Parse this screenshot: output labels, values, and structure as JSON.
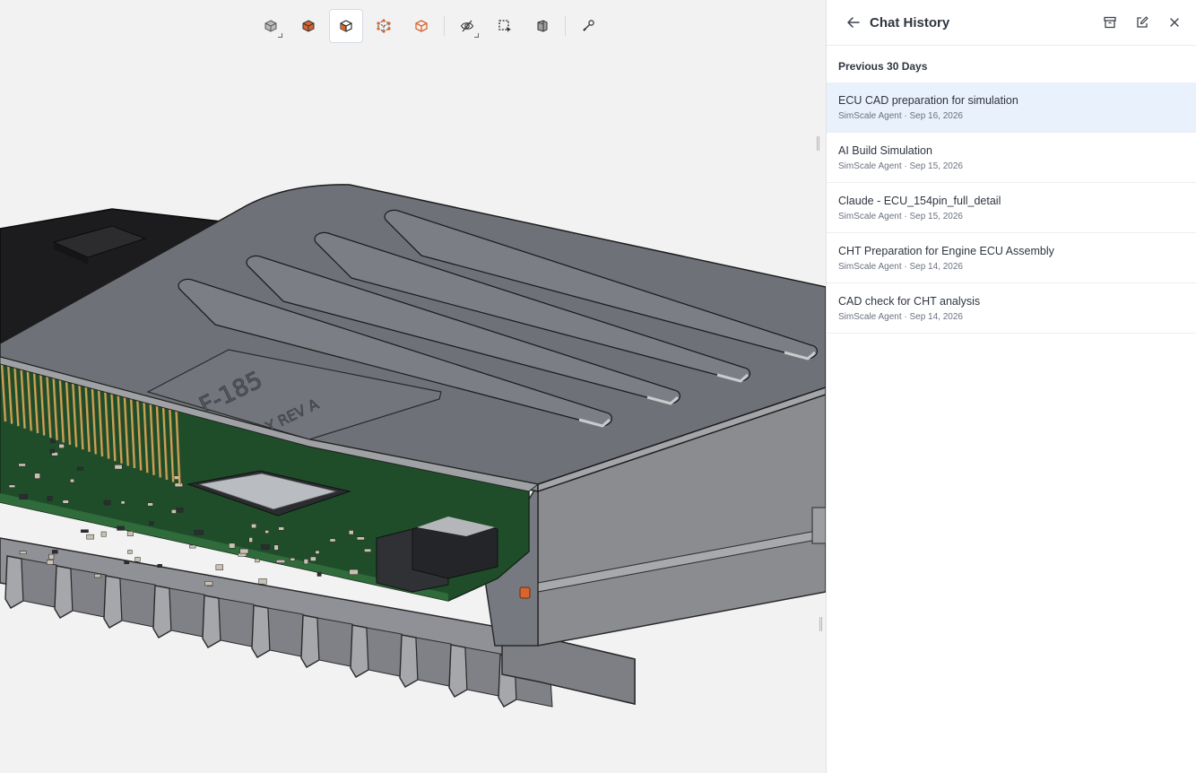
{
  "toolbar": {
    "tools": [
      {
        "name": "shaded-view-icon",
        "active": false,
        "has_menu": true
      },
      {
        "name": "solid-select-icon",
        "active": false
      },
      {
        "name": "face-select-icon",
        "active": true
      },
      {
        "name": "vertex-select-icon",
        "active": false
      },
      {
        "name": "edge-select-icon",
        "active": false
      },
      {
        "name": "visibility-toggle-icon",
        "active": false,
        "has_menu": true
      },
      {
        "name": "box-select-icon",
        "active": false
      },
      {
        "name": "section-view-icon",
        "active": false
      },
      {
        "name": "measure-tool-icon",
        "active": false
      }
    ]
  },
  "model_labels": {
    "part_number": "F-185",
    "revision": "Y REV A"
  },
  "chat_panel": {
    "title": "Chat History",
    "section_label": "Previous 30 Days",
    "items": [
      {
        "title": "ECU CAD preparation for simulation",
        "meta": "SimScale Agent · Sep 16, 2026",
        "selected": true
      },
      {
        "title": "AI Build Simulation",
        "meta": "SimScale Agent · Sep 15, 2026",
        "selected": false
      },
      {
        "title": "Claude - ECU_154pin_full_detail",
        "meta": "SimScale Agent · Sep 15, 2026",
        "selected": false
      },
      {
        "title": "CHT Preparation for Engine ECU Assembly",
        "meta": "SimScale Agent · Sep 14, 2026",
        "selected": false
      },
      {
        "title": "CAD check for CHT analysis",
        "meta": "SimScale Agent · Sep 14, 2026",
        "selected": false
      }
    ]
  },
  "colors": {
    "accent_orange": "#d9642f",
    "selected_row": "#e9f1fc",
    "pcb_green": "#1f4d2a",
    "housing_top": "#6e7278",
    "pin_gold": "#c8a35a"
  }
}
